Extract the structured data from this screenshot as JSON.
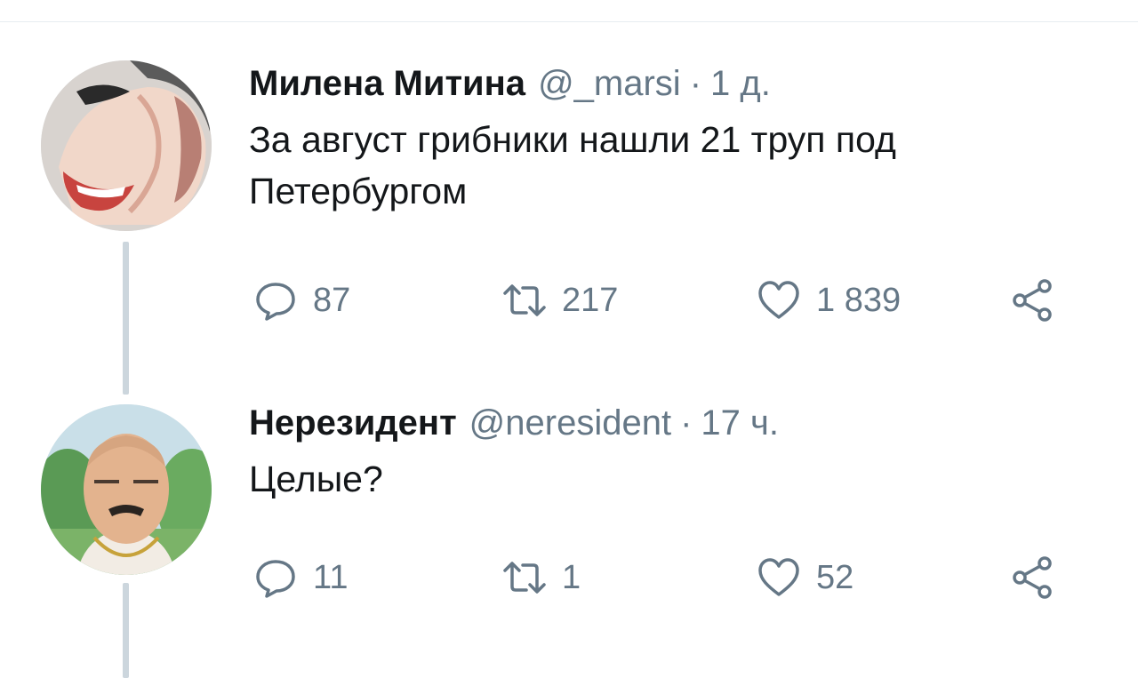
{
  "tweets": [
    {
      "name": "Милена Митина",
      "handle": "@_marsi",
      "separator": "·",
      "time": "1 д.",
      "text": "За август грибники нашли 21 труп под Петербургом",
      "replies": "87",
      "retweets": "217",
      "likes": "1 839"
    },
    {
      "name": "Нерезидент",
      "handle": "@neresident",
      "separator": "·",
      "time": "17 ч.",
      "text": "Целые?",
      "replies": "11",
      "retweets": "1",
      "likes": "52"
    }
  ],
  "icons": {
    "reply": "reply-icon",
    "retweet": "retweet-icon",
    "like": "heart-icon",
    "share": "share-icon"
  },
  "colors": {
    "text": "#14171a",
    "secondary": "#657786",
    "thread_line": "#ccd6dd",
    "divider": "#e6ecf0"
  }
}
